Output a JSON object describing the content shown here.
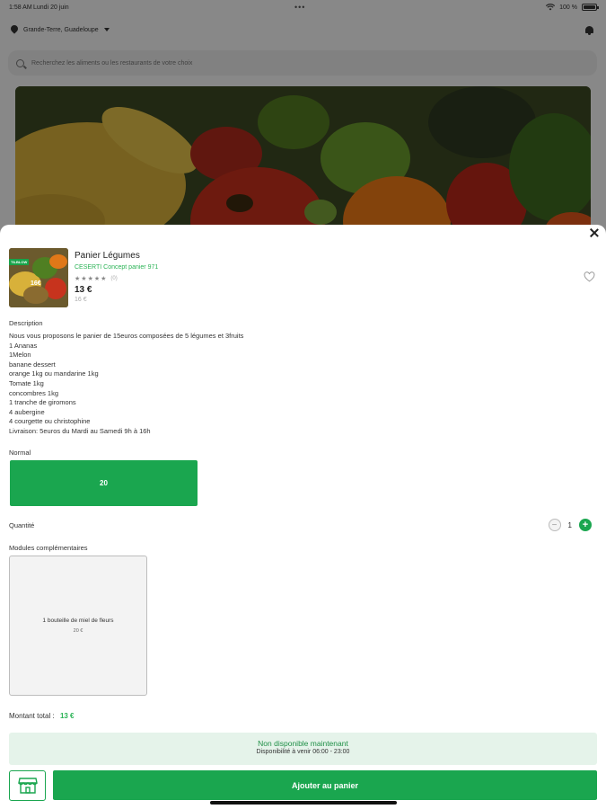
{
  "status_bar": {
    "time": "1:58 AM",
    "date": "Lundi 20 juin",
    "dots": "•••",
    "battery": "100 %"
  },
  "location": {
    "label": "Grande-Terre, Guadeloupe",
    "icon": "location-pin-icon"
  },
  "search": {
    "placeholder": "Recherchez les aliments ou les restaurants de votre choix"
  },
  "product": {
    "title": "Panier Légumes",
    "vendor": "CESERTI Concept panier 971",
    "rating_count": "(0)",
    "price": "13 €",
    "old_price": "16 €",
    "thumb_badge": "TILBLOW",
    "thumb_price": "16€"
  },
  "description": {
    "label": "Description",
    "lines": [
      "Nous vous proposons le panier de 15euros composées de 5 légumes et 3fruits",
      "1 Ananas",
      "1Melon",
      "banane dessert",
      "orange 1kg ou mandarine 1kg",
      "Tomate 1kg",
      "concombres 1kg",
      "1 tranche de giromons",
      "4 aubergine",
      "4 courgette ou christophine",
      "Livraison: 5euros du Mardi au Samedi 9h à 16h"
    ]
  },
  "option": {
    "label": "Normal",
    "value": "20"
  },
  "quantity": {
    "label": "Quantité",
    "value": "1",
    "minus": "−",
    "plus": "+"
  },
  "modules": {
    "label": "Modules complémentaires",
    "items": [
      {
        "name": "1 bouteille de miel de fleurs",
        "price": "20 €"
      }
    ]
  },
  "total": {
    "label": "Montant total :",
    "amount": "13 €"
  },
  "availability": {
    "status": "Non disponible maintenant",
    "hours": "Disponibilité à venir 06:00 - 23:00"
  },
  "actions": {
    "add_to_cart": "Ajouter au panier"
  },
  "colors": {
    "accent": "#1aa64f",
    "accent_text": "#2bb356",
    "availability_bg": "#e5f3ea"
  }
}
